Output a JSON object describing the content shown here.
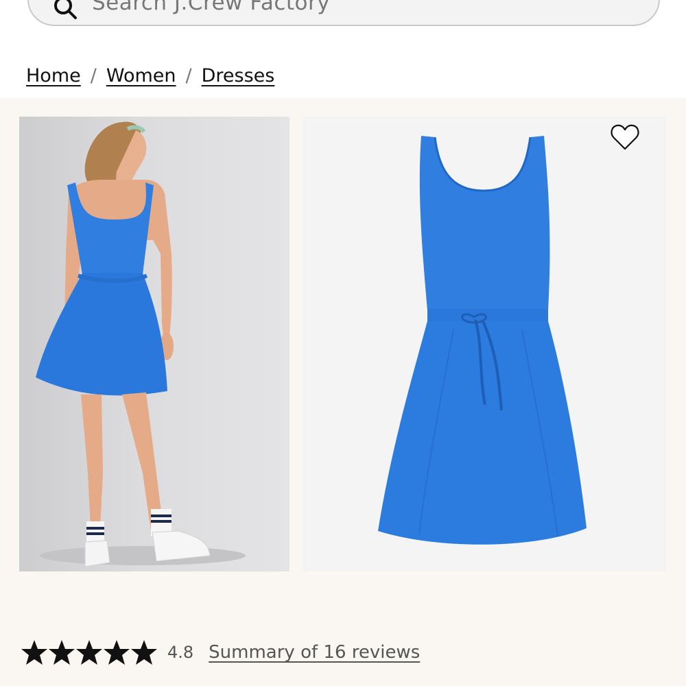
{
  "search": {
    "placeholder": "Search J.Crew Factory"
  },
  "breadcrumb": {
    "items": [
      {
        "label": "Home"
      },
      {
        "label": "Women"
      },
      {
        "label": "Dresses"
      }
    ],
    "separator": "/"
  },
  "product": {
    "images": [
      {
        "icon": "model-back-view-image"
      },
      {
        "icon": "dress-flat-image"
      }
    ],
    "dress_color": "#2f7ee0",
    "wishlist_icon": "heart-outline-icon"
  },
  "reviews": {
    "stars": 5,
    "rating": "4.8",
    "summary_link": "Summary of 16 reviews"
  }
}
